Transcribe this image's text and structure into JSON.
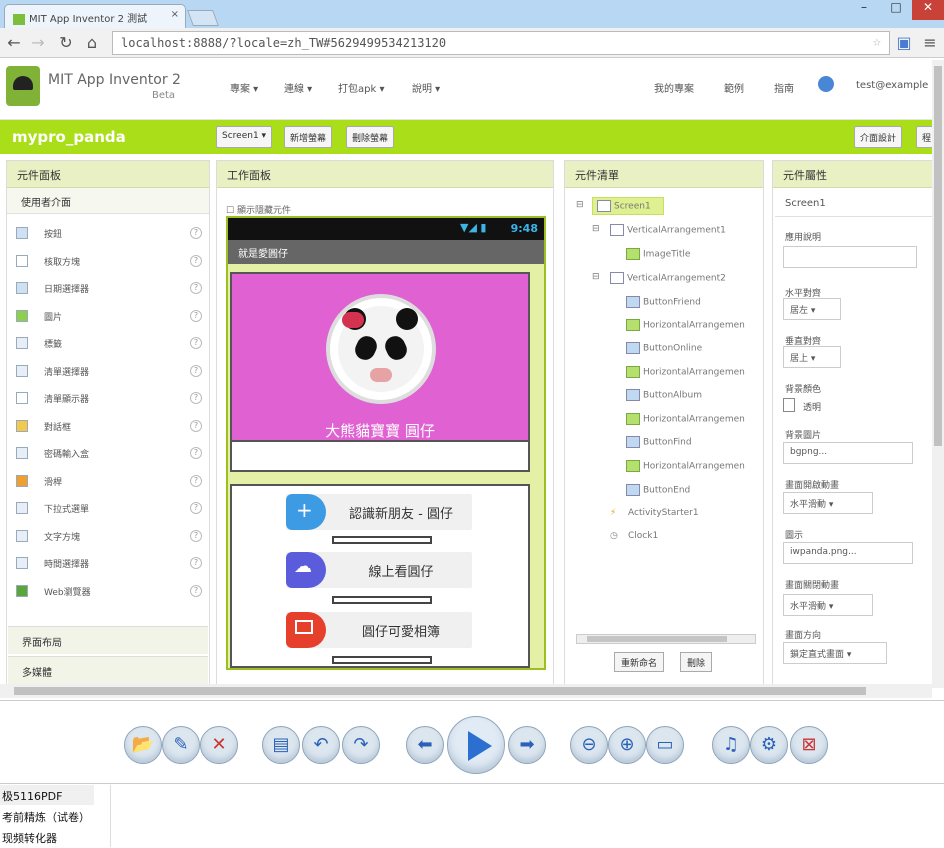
{
  "browser": {
    "tab_title": "MIT App Inventor 2 測試",
    "address": "localhost:8888/?locale=zh_TW#5629499534213120"
  },
  "app": {
    "title": "MIT App Inventor 2",
    "beta": "Beta",
    "menus": [
      "專案 ▾",
      "連線 ▾",
      "打包apk ▾",
      "說明 ▾"
    ],
    "right_links": [
      "我的專案",
      "範例",
      "指南"
    ],
    "user": "test@example"
  },
  "project": {
    "name": "mypro_panda",
    "screen_select": "Screen1 ▾",
    "add_screen": "新增螢幕",
    "remove_screen": "刪除螢幕",
    "designer_btn": "介面設計",
    "blocks_btn": "程"
  },
  "palette": {
    "header": "元件面板",
    "section": "使用者介面",
    "items": [
      "按鈕",
      "核取方塊",
      "日期選擇器",
      "圖片",
      "標籤",
      "清單選擇器",
      "清單顯示器",
      "對話框",
      "密碼輸入盒",
      "滑桿",
      "下拉式選單",
      "文字方塊",
      "時間選擇器",
      "Web瀏覽器"
    ],
    "footer1": "界面布局",
    "footer2": "多媒體"
  },
  "viewer": {
    "header": "工作面板",
    "hidden_check": "顯示隱藏元件",
    "status_time": "9:48",
    "screen_title": "就是愛圓仔",
    "caption": "大熊貓寶寶 圓仔",
    "buttons": [
      "認識新朋友 - 圓仔",
      "線上看圓仔",
      "圓仔可愛相簿"
    ]
  },
  "components": {
    "header": "元件清單",
    "tree": [
      "Screen1",
      "VerticalArrangement1",
      "ImageTitle",
      "VerticalArrangement2",
      "ButtonFriend",
      "HorizontalArrangemen",
      "ButtonOnline",
      "HorizontalArrangemen",
      "ButtonAlbum",
      "HorizontalArrangemen",
      "ButtonFind",
      "HorizontalArrangemen",
      "ButtonEnd",
      "ActivityStarter1",
      "Clock1"
    ],
    "rename_btn": "重新命名",
    "delete_btn": "刪除"
  },
  "properties": {
    "header": "元件屬性",
    "component": "Screen1",
    "labels": [
      "應用說明",
      "水平對齊",
      "垂直對齊",
      "背景顏色",
      "背景圖片",
      "畫面開啟動畫",
      "圖示",
      "畫面關閉動畫",
      "畫面方向"
    ],
    "values": {
      "h_align": "居左 ▾",
      "v_align": "居上 ▾",
      "bg_color": "透明",
      "bg_image": "bgpng...",
      "open_anim": "水平滑動 ▾",
      "icon": "iwpanda.png...",
      "close_anim": "水平滑動 ▾",
      "orientation": "鎖定直式畫面 ▾"
    }
  },
  "bottom": {
    "items": [
      "极5116PDF",
      "考前精炼（试卷）",
      "现频转化器"
    ]
  },
  "colors": {
    "accent_green": "#a9de18",
    "panel_header": "#e8f0c4",
    "pink": "#e061d2"
  }
}
